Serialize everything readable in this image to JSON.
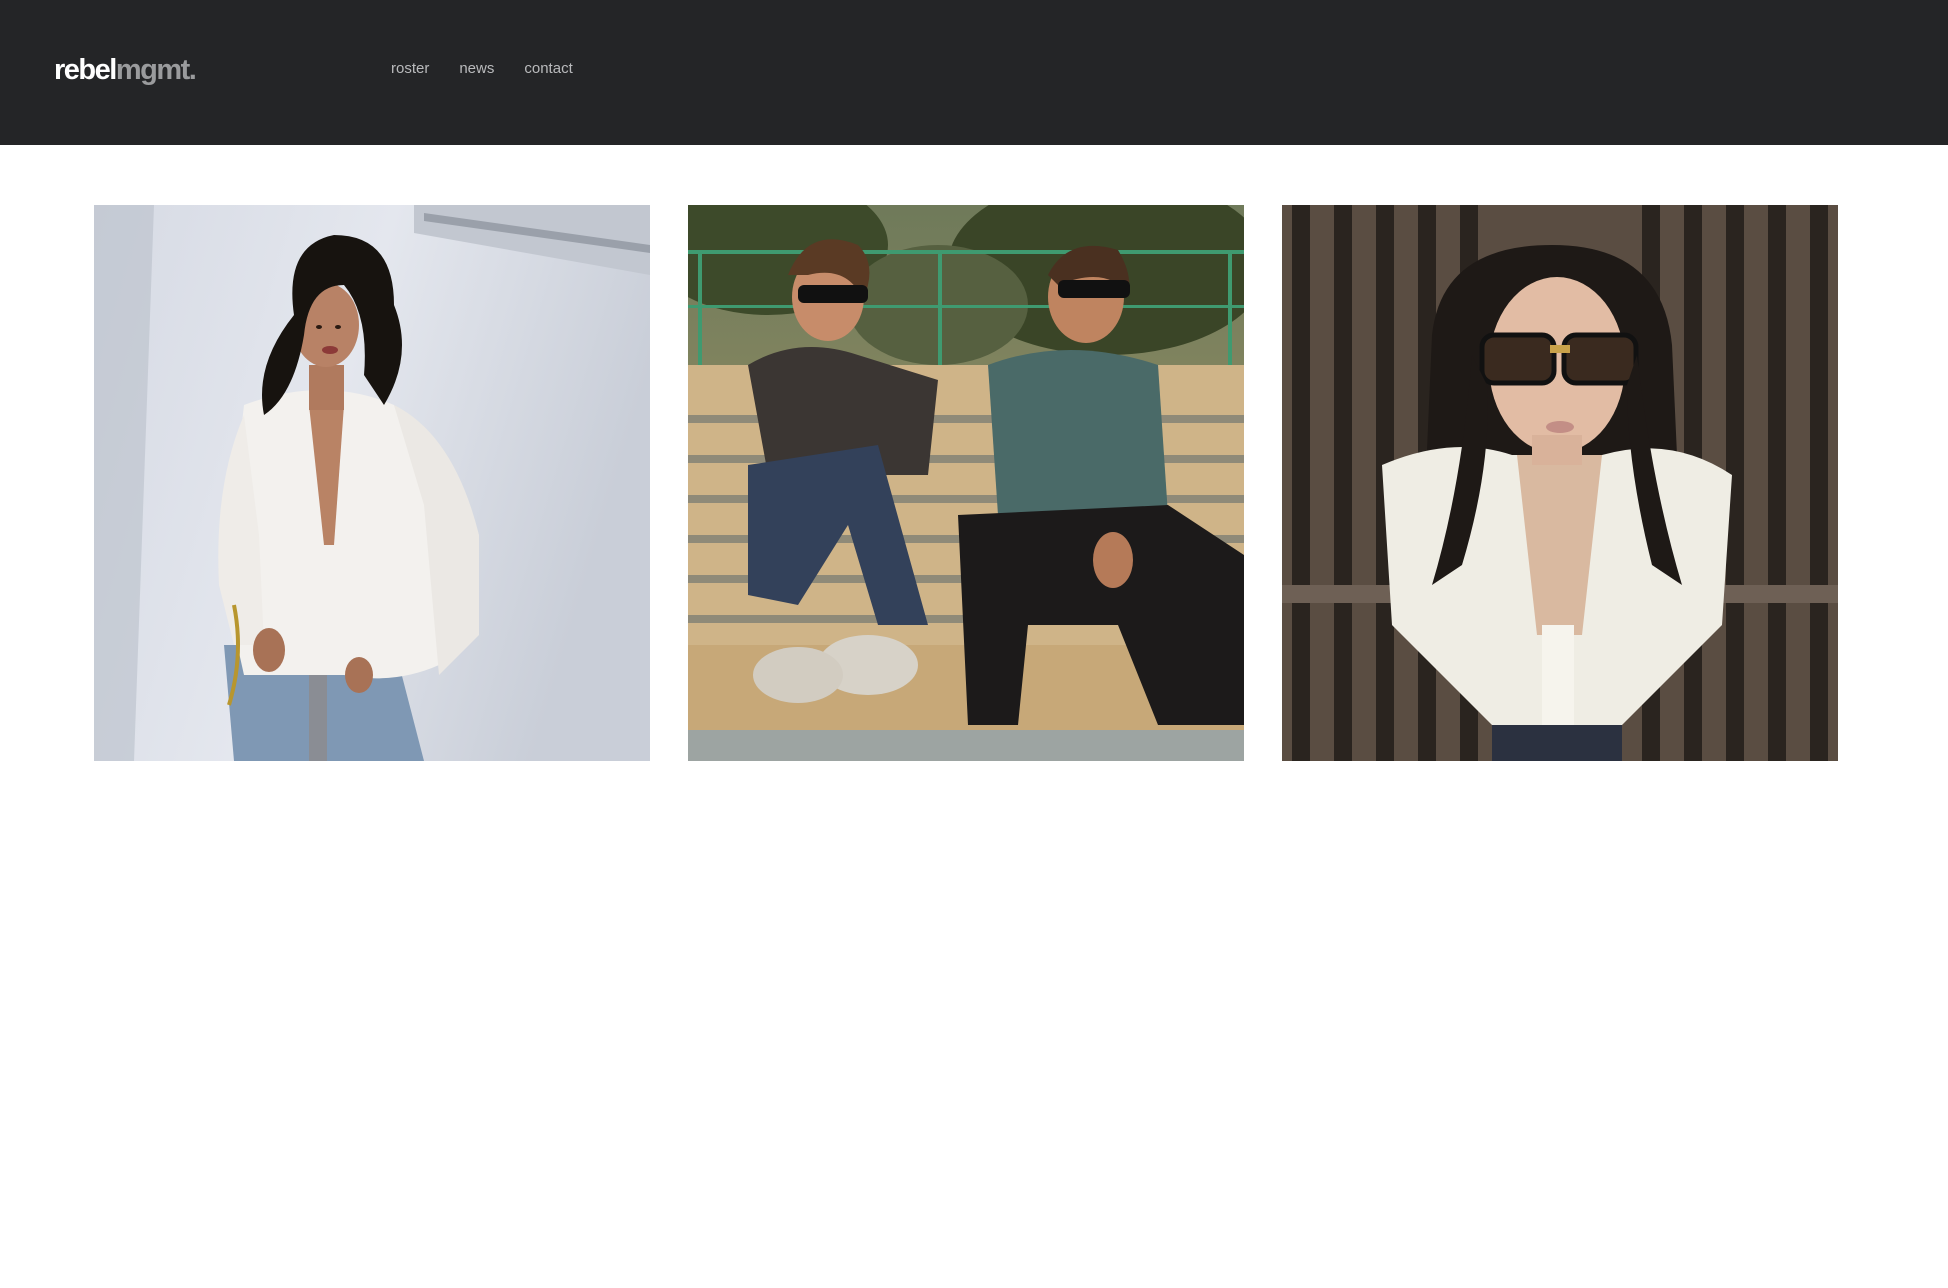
{
  "header": {
    "logo": {
      "part1": "rebel",
      "part2": "mgmt."
    },
    "nav": [
      {
        "label": "roster"
      },
      {
        "label": "news"
      },
      {
        "label": "contact"
      }
    ]
  },
  "roster": {
    "tiles": [
      {
        "name": "artist-photo-1",
        "icon": "woman-white-blouse-photo"
      },
      {
        "name": "artist-photo-2",
        "icon": "duo-on-bleachers-photo"
      },
      {
        "name": "artist-photo-3",
        "icon": "woman-sunglasses-photo"
      }
    ]
  },
  "colors": {
    "header_bg": "#242527",
    "logo_primary": "#ffffff",
    "logo_secondary": "#9a9b9d",
    "nav_text": "#b9babc",
    "page_bg": "#ffffff"
  }
}
